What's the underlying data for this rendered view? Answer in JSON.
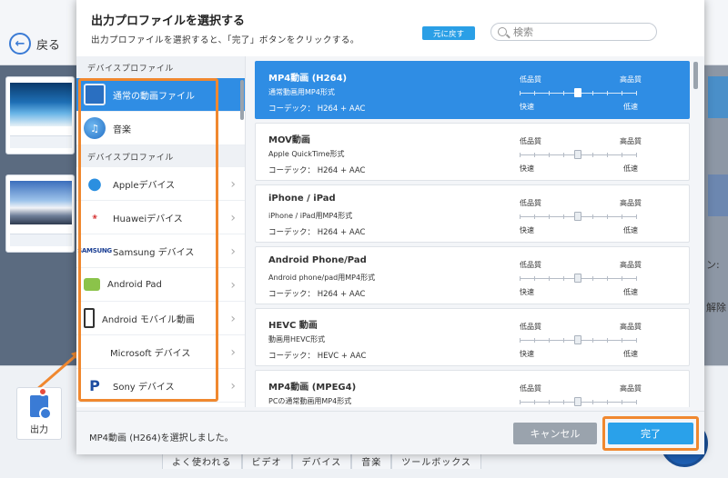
{
  "background": {
    "back_label": "戻る",
    "output_label": "出力",
    "right_texts": [
      "ン:",
      "解除"
    ],
    "bottom_tabs": [
      "よく使われる",
      "ビデオ",
      "デバイス",
      "音楽",
      "ツールボックス"
    ]
  },
  "dialog": {
    "title": "出力プロファイルを選択する",
    "subtitle": "出力プロファイルを選択すると、「完了」ボタンをクリックする。",
    "revert_label": "元に戻す",
    "search_placeholder": "検索",
    "categories": [
      {
        "type": "section",
        "label": "デバイスプロファイル"
      },
      {
        "type": "item",
        "label": "通常の動画ファイル",
        "icon": "tv-icon",
        "active": true,
        "chevron": false
      },
      {
        "type": "item",
        "label": "音楽",
        "icon": "music-icon",
        "active": false,
        "chevron": false
      },
      {
        "type": "section",
        "label": "デバイスプロファイル"
      },
      {
        "type": "item",
        "label": "Appleデバイス",
        "icon": "apple-icon",
        "active": false,
        "chevron": true
      },
      {
        "type": "item",
        "label": "Huaweiデバイス",
        "icon": "huawei-icon",
        "active": false,
        "chevron": true
      },
      {
        "type": "item",
        "label": "Samsung デバイス",
        "icon": "samsung-icon",
        "active": false,
        "chevron": true
      },
      {
        "type": "item",
        "label": "Android Pad",
        "icon": "android-pad-icon",
        "active": false,
        "chevron": true
      },
      {
        "type": "item",
        "label": "Android モバイル動画",
        "icon": "phone-icon",
        "active": false,
        "chevron": true
      },
      {
        "type": "item",
        "label": "Microsoft デバイス",
        "icon": "microsoft-icon",
        "active": false,
        "chevron": true
      },
      {
        "type": "item",
        "label": "Sony デバイス",
        "icon": "playstation-icon",
        "active": false,
        "chevron": true
      }
    ],
    "profiles": [
      {
        "name": "MP4動画 (H264)",
        "desc": "通常動画用MP4形式",
        "codec": "コーデック： H264 + AAC",
        "active": true,
        "quality_level": 0.5
      },
      {
        "name": "MOV動画",
        "desc": "Apple QuickTime形式",
        "codec": "コーデック： H264 + AAC",
        "active": false,
        "quality_level": 0.5
      },
      {
        "name": "iPhone / iPad",
        "desc": "iPhone / iPad用MP4形式",
        "codec": "コーデック： H264 + AAC",
        "active": false,
        "quality_level": 0.5
      },
      {
        "name": "Android Phone/Pad",
        "desc": "Android phone/pad用MP4形式",
        "codec": "コーデック： H264 + AAC",
        "active": false,
        "quality_level": 0.5
      },
      {
        "name": "HEVC 動画",
        "desc": "動画用HEVC形式",
        "codec": "コーデック： HEVC + AAC",
        "active": false,
        "quality_level": 0.5
      },
      {
        "name": "MP4動画 (MPEG4)",
        "desc": "PCの通常動画用MP4形式",
        "codec": "",
        "active": false,
        "quality_level": 0.5
      }
    ],
    "quality_low": "低品質",
    "quality_high": "高品質",
    "speed_fast": "快速",
    "speed_slow": "低速",
    "status": "MP4動画 (H264)を選択しました。",
    "cancel_label": "キャンセル",
    "done_label": "完了"
  },
  "colors": {
    "accent": "#2f8de4",
    "highlight": "#f0882f",
    "done_button": "#2aa1ea",
    "cancel_button": "#9aa3ad"
  }
}
